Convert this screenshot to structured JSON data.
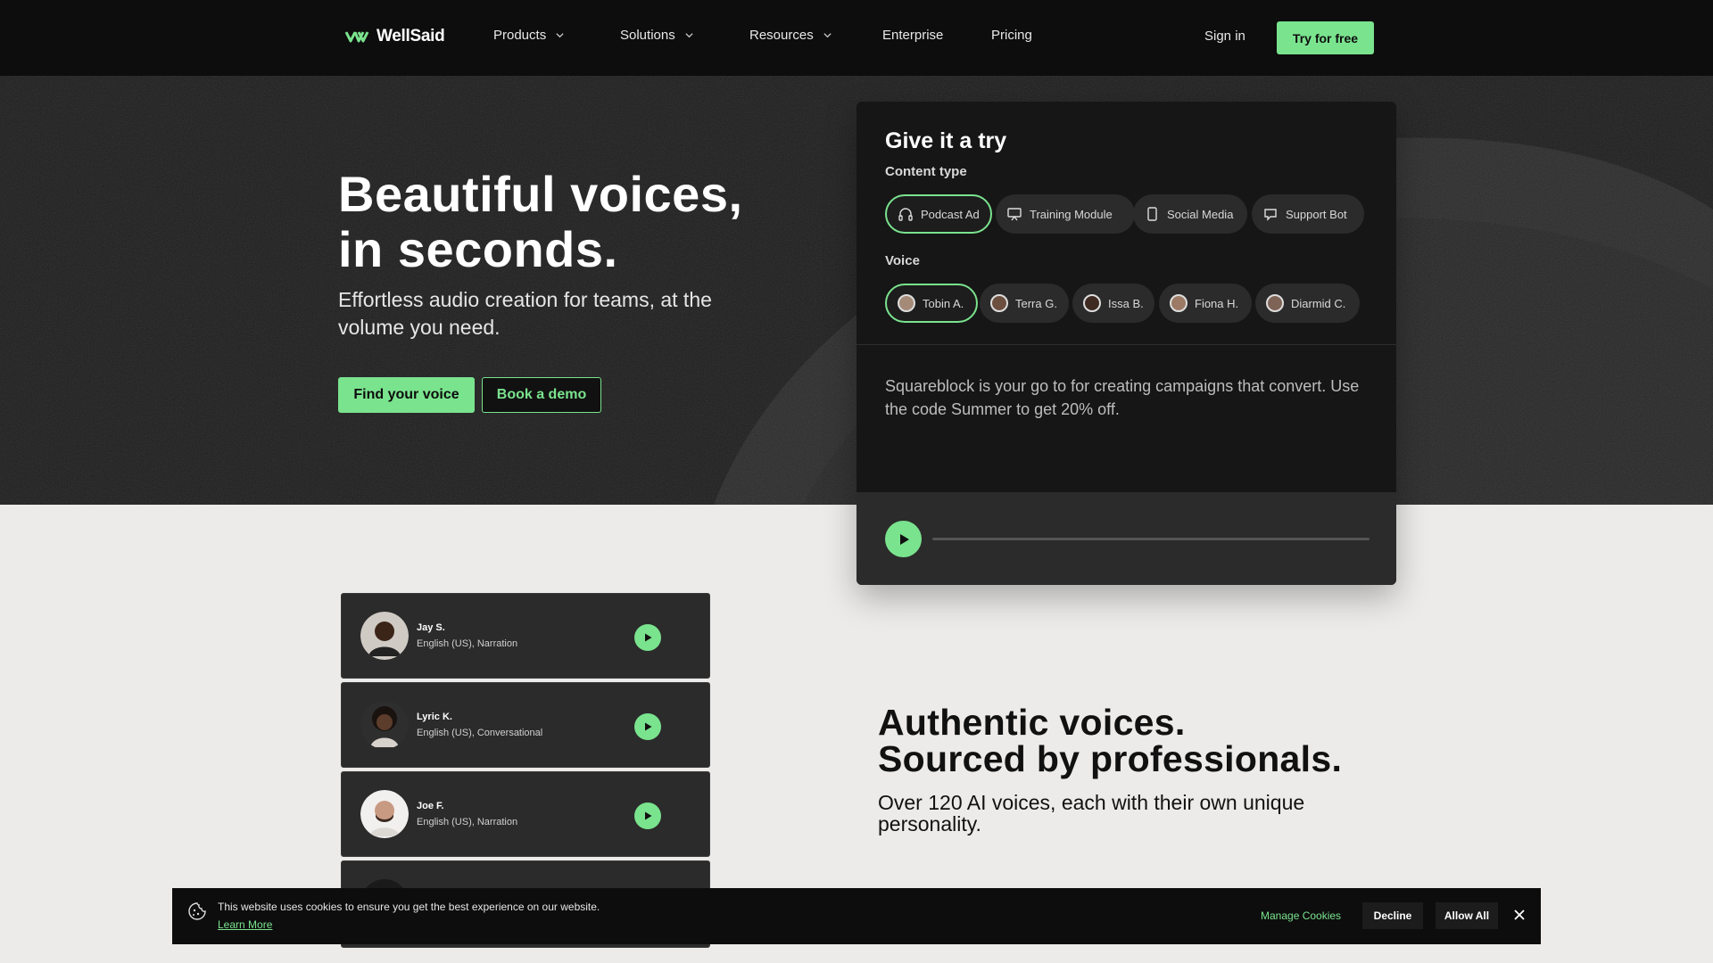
{
  "brand": {
    "name": "WellSaid",
    "accent": "#7ae38e"
  },
  "nav": {
    "items": [
      {
        "label": "Products",
        "has_dropdown": true
      },
      {
        "label": "Solutions",
        "has_dropdown": true
      },
      {
        "label": "Resources",
        "has_dropdown": true
      },
      {
        "label": "Enterprise",
        "has_dropdown": false
      },
      {
        "label": "Pricing",
        "has_dropdown": false
      }
    ],
    "sign_in": "Sign in",
    "cta": "Try for free"
  },
  "hero": {
    "title_line1": "Beautiful voices,",
    "title_line2": "in seconds.",
    "subtitle": "Effortless audio creation for teams, at the volume you need.",
    "primary_button": "Find your voice",
    "secondary_button": "Book a demo"
  },
  "try_card": {
    "title": "Give it a try",
    "content_type_label": "Content type",
    "content_types": [
      {
        "label": "Podcast Ad",
        "icon": "headphones-icon",
        "selected": true
      },
      {
        "label": "Training Module",
        "icon": "presentation-icon",
        "selected": false
      },
      {
        "label": "Social Media",
        "icon": "phone-icon",
        "selected": false
      },
      {
        "label": "Support Bot",
        "icon": "chat-icon",
        "selected": false
      }
    ],
    "voice_label": "Voice",
    "voices": [
      {
        "label": "Tobin A.",
        "selected": true
      },
      {
        "label": "Terra G.",
        "selected": false
      },
      {
        "label": "Issa B.",
        "selected": false
      },
      {
        "label": "Fiona H.",
        "selected": false
      },
      {
        "label": "Diarmid C.",
        "selected": false
      }
    ],
    "sample_text": "Squareblock is your go to for creating campaigns that convert. Use the code Summer to get 20% off.",
    "progress": 0
  },
  "voice_list": [
    {
      "name": "Jay S.",
      "meta": "English (US), Narration"
    },
    {
      "name": "Lyric K.",
      "meta": "English (US), Conversational"
    },
    {
      "name": "Joe F.",
      "meta": "English (US), Narration"
    }
  ],
  "authentic": {
    "title_line1": "Authentic voices.",
    "title_line2": "Sourced by professionals.",
    "subtitle": "Over 120 AI voices, each with their own unique personality."
  },
  "cookie": {
    "text": "This website uses cookies to ensure you get the best experience on our website.",
    "learn_more": "Learn More",
    "manage": "Manage Cookies",
    "decline": "Decline",
    "allow": "Allow All"
  }
}
